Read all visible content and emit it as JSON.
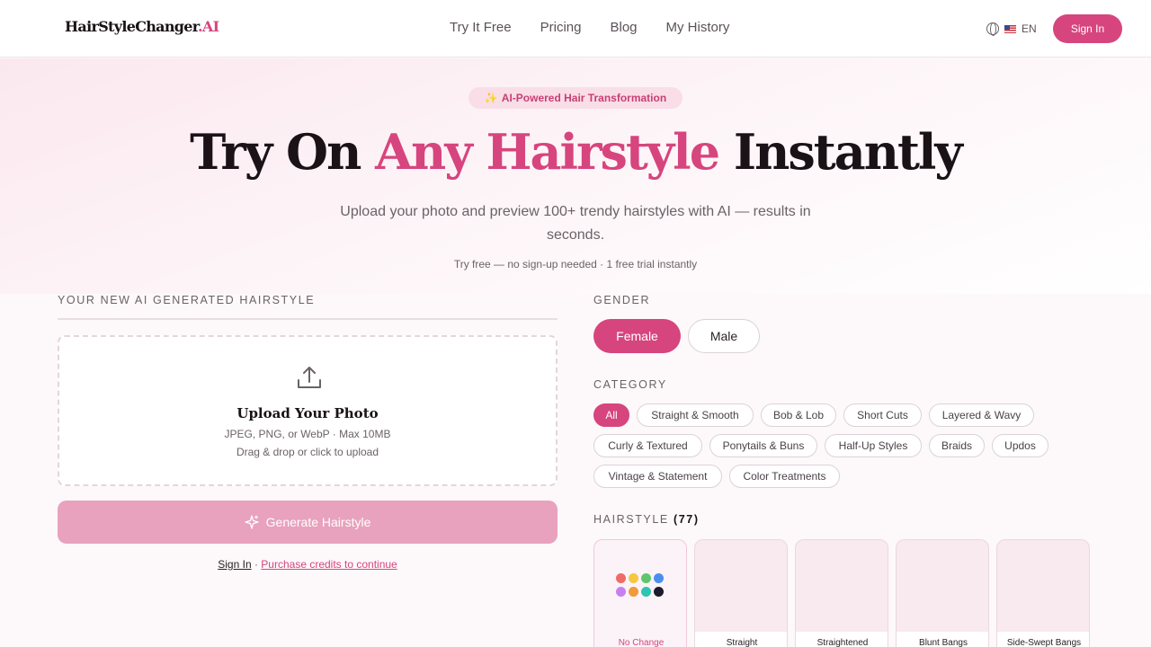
{
  "nav": {
    "logo_main": "HairStyleChanger",
    "logo_ai": ".AI",
    "links": [
      "Try It Free",
      "Pricing",
      "Blog",
      "My History"
    ],
    "lang": "EN",
    "sign_in": "Sign In"
  },
  "hero": {
    "badge": "AI-Powered Hair Transformation",
    "title_pre": "Try On ",
    "title_accent": "Any Hairstyle",
    "title_post": " Instantly",
    "subtitle": "Upload your photo and preview 100+ trendy hairstyles with AI — results in seconds.",
    "note": "Try free — no sign-up needed · 1 free trial instantly"
  },
  "left": {
    "section_label": "YOUR NEW AI GENERATED HAIRSTYLE",
    "upload_title": "Upload Your Photo",
    "upload_formats": "JPEG, PNG, or WebP · Max 10MB",
    "upload_hint": "Drag & drop or click to upload",
    "generate_label": "Generate Hairstyle",
    "sign_in_link": "Sign In",
    "separator": " · ",
    "purchase_link": "Purchase credits to continue"
  },
  "right": {
    "gender_label": "GENDER",
    "genders": [
      "Female",
      "Male"
    ],
    "category_label": "CATEGORY",
    "categories": [
      "All",
      "Straight & Smooth",
      "Bob & Lob",
      "Short Cuts",
      "Layered & Wavy",
      "Curly & Textured",
      "Ponytails & Buns",
      "Half-Up Styles",
      "Braids",
      "Updos",
      "Vintage & Statement",
      "Color Treatments"
    ],
    "hairstyle_label": "HAIRSTYLE",
    "hairstyle_count": "(77)",
    "hairstyles": [
      "No Change",
      "Straight",
      "Straightened",
      "Blunt Bangs",
      "Side-Swept Bangs"
    ]
  },
  "colors": {
    "accent": "#d6457e",
    "accent_soft": "#e8a2bd",
    "palette_dots": [
      "#f06a6a",
      "#f5c842",
      "#5cc76a",
      "#4a8ff0",
      "#c77ff0",
      "#f09a3a",
      "#2fc4b2",
      "#1e1a2e"
    ]
  }
}
